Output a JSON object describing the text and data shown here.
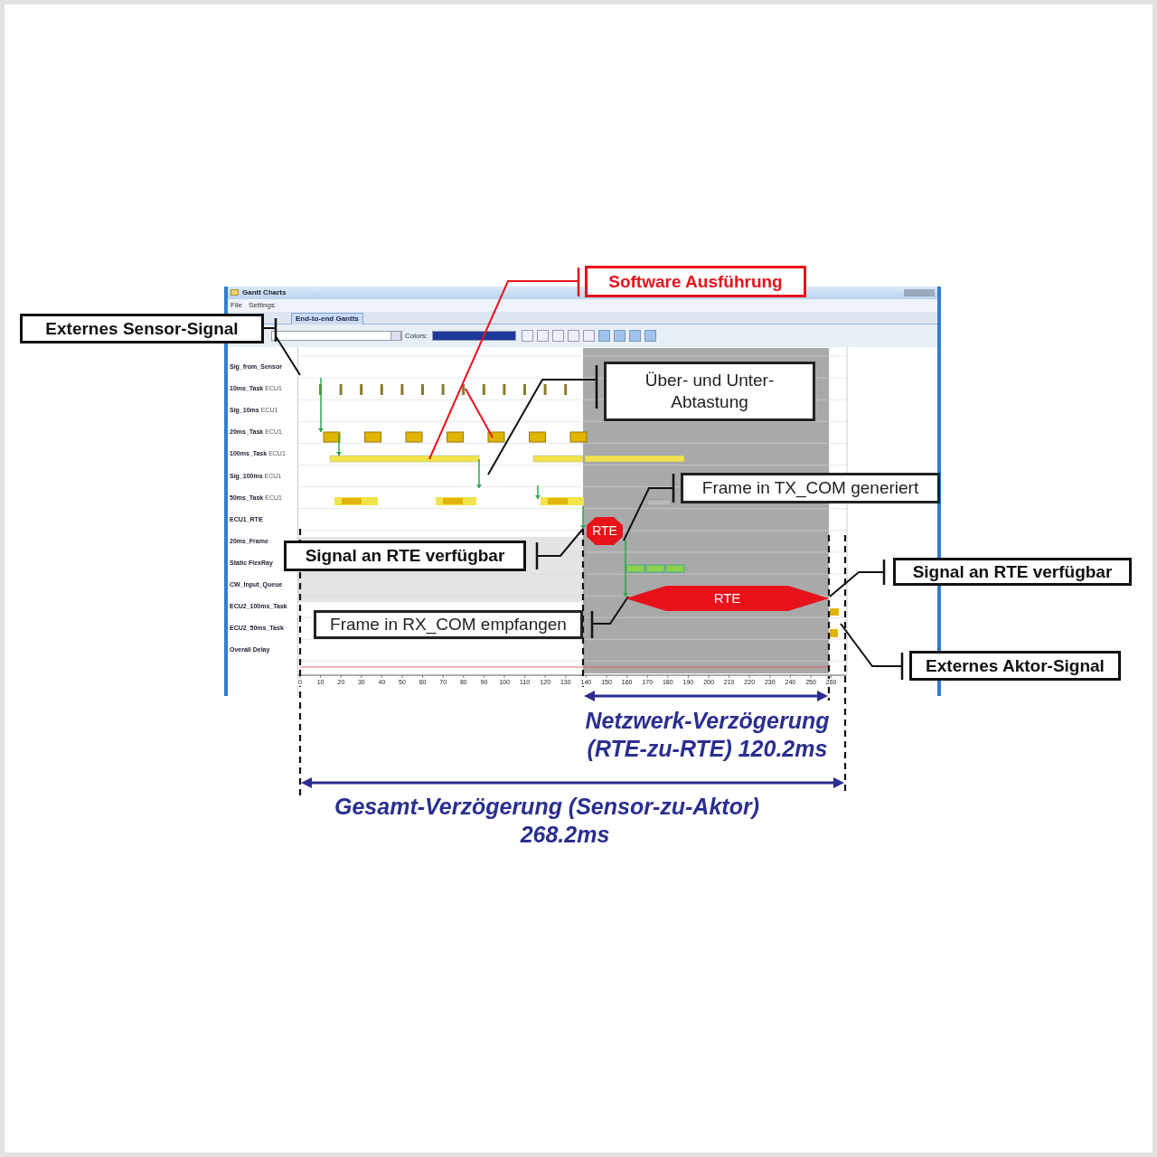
{
  "window": {
    "title": "Gantt Charts",
    "menu": [
      "File",
      "Settings"
    ],
    "tabs": [
      {
        "label": "End-to-end Gantts",
        "selected": true
      }
    ],
    "toolbar": {
      "colors_label": "Colors:"
    }
  },
  "gantt": {
    "rows": [
      {
        "label": "Sig_from_Sensor"
      },
      {
        "label": "10ms_Task",
        "ecu": "ECU1"
      },
      {
        "label": "Sig_10ms",
        "ecu": "ECU1"
      },
      {
        "label": "20ms_Task",
        "ecu": "ECU1"
      },
      {
        "label": "100ms_Task",
        "ecu": "ECU1"
      },
      {
        "label": "Sig_100ms",
        "ecu": "ECU1"
      },
      {
        "label": "50ms_Task",
        "ecu": "ECU1"
      },
      {
        "label": "ECU1_RTE"
      },
      {
        "label": "20ms_Frame"
      },
      {
        "label": "Static FlexRay"
      },
      {
        "label": "CW_Input_Queue"
      },
      {
        "label": "ECU2_100ms_Task"
      },
      {
        "label": "ECU2_50ms_Task"
      },
      {
        "label": "Overall Delay"
      }
    ],
    "ticks": [
      "0",
      "10",
      "20",
      "30",
      "40",
      "50",
      "60",
      "70",
      "80",
      "90",
      "100",
      "110",
      "120",
      "130",
      "140",
      "150",
      "160",
      "170",
      "180",
      "190",
      "200",
      "210",
      "220",
      "230",
      "240",
      "250",
      "260"
    ],
    "rte_markers": [
      "RTE",
      "RTE"
    ]
  },
  "callouts": [
    {
      "kind": "bold",
      "text": "Externes Sensor-Signal"
    },
    {
      "kind": "red",
      "text": "Software Ausführung"
    },
    {
      "kind": "plain",
      "text": "Über- und Unter-\nAbtastung"
    },
    {
      "kind": "plain",
      "text": "Frame in TX_COM generiert"
    },
    {
      "kind": "bold",
      "text": "Signal an RTE  verfügbar"
    },
    {
      "kind": "bold",
      "text": "Signal an RTE  verfügbar"
    },
    {
      "kind": "plain",
      "text": "Frame in RX_COM empfangen"
    },
    {
      "kind": "bold",
      "text": "Externes Aktor-Signal"
    }
  ],
  "delays": [
    {
      "lines": [
        "Netzwerk-Verzögerung",
        "(RTE-zu-RTE) 120.2ms"
      ]
    },
    {
      "lines": [
        "Gesamt-Verzögerung (Sensor-zu-Aktor)",
        "268.2ms"
      ]
    }
  ]
}
